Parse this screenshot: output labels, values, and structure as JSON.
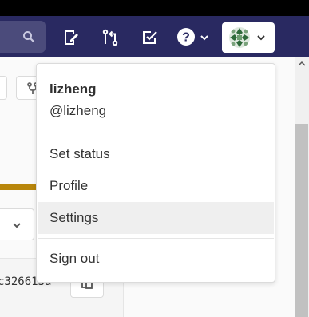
{
  "navbar": {
    "icons": [
      "search-icon",
      "issues-icon",
      "merge-request-icon",
      "todos-icon",
      "help-icon"
    ],
    "help_chevron": "chevron-down-icon",
    "avatar_chevron": "chevron-down-icon"
  },
  "background": {
    "commit_sha": "c326613a",
    "accent_color": "#b8860b"
  },
  "dropdown": {
    "user_name": "lizheng",
    "user_handle": "@lizheng",
    "items": [
      {
        "label": "Set status"
      },
      {
        "label": "Profile"
      },
      {
        "label": "Settings"
      },
      {
        "label": "Sign out"
      }
    ],
    "highlighted": "Settings"
  },
  "colors": {
    "navbar": "#292961",
    "search": "#4b4b7b",
    "hover": "#efefef"
  }
}
